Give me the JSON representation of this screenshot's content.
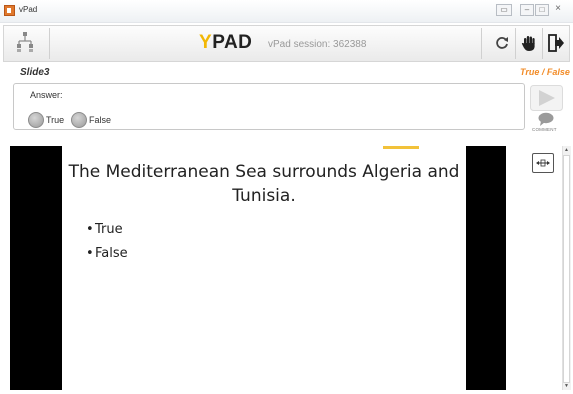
{
  "window": {
    "title": "vPad",
    "buttons": {
      "restore": "▭",
      "minimize": "–",
      "maximize": "□",
      "close": "×"
    }
  },
  "toolbar": {
    "logo_y": "Y",
    "logo_rest": "PAD",
    "session_text": "vPad session: 362388",
    "icons": [
      "network-icon",
      "refresh-icon",
      "hand-raise-icon",
      "exit-icon"
    ]
  },
  "slide": {
    "name": "Slide3",
    "type": "True / False"
  },
  "answer": {
    "label": "Answer:",
    "options": [
      "True",
      "False"
    ],
    "comment_label": "COMMENT"
  },
  "presentation": {
    "question": "The Mediterranean Sea surrounds Algeria and Tunisia.",
    "bullets": [
      "True",
      "False"
    ]
  },
  "colors": {
    "accent": "#f2b705",
    "slide_type": "#f28c28",
    "letterbox": "#000000"
  }
}
